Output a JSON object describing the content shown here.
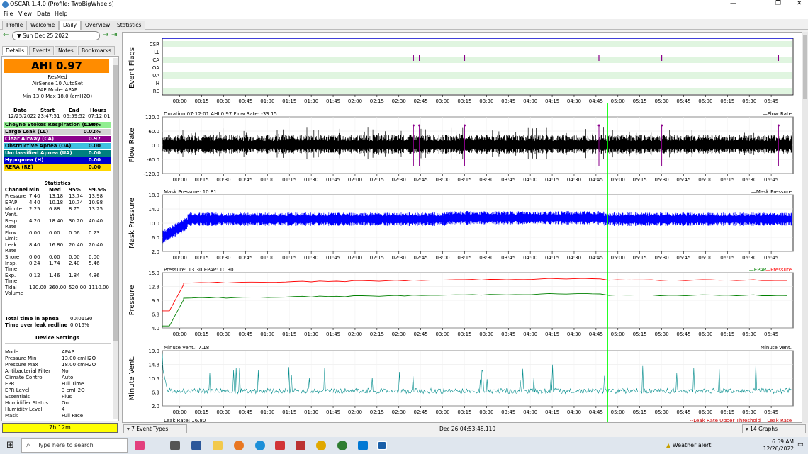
{
  "window": {
    "title": "OSCAR 1.4.0 (Profile: TwoBigWheels)"
  },
  "menu": [
    "File",
    "View",
    "Data",
    "Help"
  ],
  "tabs": [
    "Profile",
    "Welcome",
    "Daily",
    "Overview",
    "Statistics"
  ],
  "active_tab": "Daily",
  "date": "Sun Dec 25 2022",
  "left_tabs": [
    "Details",
    "Events",
    "Notes",
    "Bookmarks"
  ],
  "ahi": "AHI 0.97",
  "device": {
    "brand": "ResMed",
    "model": "AirSense 10 AutoSet",
    "pap_mode": "PAP Mode: APAP",
    "pressure_range": "Min 13.0 Max 18.0 (cmH2O)"
  },
  "session": {
    "headers": [
      "Date",
      "Start",
      "End",
      "Hours"
    ],
    "values": [
      "12/25/2022",
      "23:47:51",
      "06:59:52",
      "07:12:01"
    ]
  },
  "events": [
    {
      "label": "Cheyne Stokes Respiration (CSR)",
      "value": "0.00%",
      "color": "#90ee90",
      "text_color": "#000"
    },
    {
      "label": "Large Leak (LL)",
      "value": "0.02%",
      "color": "#d3d3d3",
      "text_color": "#000"
    },
    {
      "label": "Clear Airway (CA)",
      "value": "0.97",
      "color": "#8b008b",
      "text_color": "#fff"
    },
    {
      "label": "Obstructive Apnea (OA)",
      "value": "0.00",
      "color": "#40c0e0",
      "text_color": "#000"
    },
    {
      "label": "Unclassified Apnea (UA)",
      "value": "0.00",
      "color": "#008080",
      "text_color": "#fff"
    },
    {
      "label": "Hypopnea (H)",
      "value": "0.00",
      "color": "#0000cd",
      "text_color": "#fff"
    },
    {
      "label": "RERA (RE)",
      "value": "0.00",
      "color": "#ffd700",
      "text_color": "#000"
    }
  ],
  "statistics": {
    "title": "Statistics",
    "headers": [
      "Channel",
      "Min",
      "Med",
      "95%",
      "99.5%"
    ],
    "rows": [
      [
        "Pressure",
        "7.40",
        "13.18",
        "13.74",
        "13.98"
      ],
      [
        "EPAP",
        "4.40",
        "10.18",
        "10.74",
        "10.98"
      ],
      [
        "Minute Vent.",
        "2.25",
        "6.88",
        "8.75",
        "13.25"
      ],
      [
        "Resp. Rate",
        "4.20",
        "18.40",
        "30.20",
        "40.40"
      ],
      [
        "Flow Limit.",
        "0.00",
        "0.00",
        "0.06",
        "0.23"
      ],
      [
        "Leak Rate",
        "8.40",
        "16.80",
        "20.40",
        "20.40"
      ],
      [
        "Snore",
        "0.00",
        "0.00",
        "0.00",
        "0.00"
      ],
      [
        "Insp. Time",
        "0.24",
        "1.74",
        "2.40",
        "5.46"
      ],
      [
        "Exp. Time",
        "0.12",
        "1.46",
        "1.84",
        "4.86"
      ],
      [
        "Tidal Volume",
        "120.00",
        "360.00",
        "520.00",
        "1110.00"
      ]
    ],
    "apnea_time_label": "Total time in apnea",
    "apnea_time": "00:01:30",
    "leak_label": "Time over leak redline",
    "leak_value": "0.015%"
  },
  "device_settings": {
    "title": "Device Settings",
    "rows": [
      [
        "Mode",
        "APAP"
      ],
      [
        "Pressure Min",
        "13.00 cmH2O"
      ],
      [
        "Pressure Max",
        "18.00 cmH2O"
      ],
      [
        "Antibacterial Filter",
        "No"
      ],
      [
        "Climate Control",
        "Auto"
      ],
      [
        "EPR",
        "Full Time"
      ],
      [
        "EPR Level",
        "3 cmH2O"
      ],
      [
        "Essentials",
        "Plus"
      ],
      [
        "Humidifier Status",
        "On"
      ],
      [
        "Humidity Level",
        "4"
      ],
      [
        "Mask",
        "Full Face"
      ]
    ]
  },
  "duration": "7h 12m",
  "time_ticks": [
    "00:00",
    "00:15",
    "00:30",
    "00:45",
    "01:00",
    "01:15",
    "01:30",
    "01:45",
    "02:00",
    "02:15",
    "02:30",
    "02:45",
    "03:00",
    "03:15",
    "03:30",
    "03:45",
    "04:00",
    "04:15",
    "04:30",
    "04:45",
    "05:00",
    "05:15",
    "05:30",
    "05:45",
    "06:00",
    "06:15",
    "06:30",
    "06:45"
  ],
  "graphs": {
    "event_flags": {
      "ylabel": "Event Flags",
      "rows": [
        "CSR",
        "LL",
        "CA",
        "OA",
        "UA",
        "H",
        "RE"
      ]
    },
    "flow_rate": {
      "ylabel": "Flow Rate",
      "header": "Duration 07:12:01 AHI 0.97 Flow Rate: -33.15",
      "legend": "Flow Rate",
      "yticks": [
        "120.0",
        "60.0",
        "0.0",
        "-60.0",
        "-120.0"
      ]
    },
    "mask_pressure": {
      "ylabel": "Mask Pressure",
      "header": "Mask Pressure: 10.81",
      "legend": "Mask Pressure",
      "yticks": [
        "18.0",
        "14.0",
        "10.0",
        "6.0",
        "2.0"
      ]
    },
    "pressure": {
      "ylabel": "Pressure",
      "header": "Pressure: 13.30 EPAP: 10.30",
      "legend_epap": "EPAP",
      "legend_pressure": "Pressure",
      "yticks": [
        "15.0",
        "12.3",
        "9.5",
        "6.8",
        "4.0"
      ]
    },
    "minute_vent": {
      "ylabel": "Minute Vent.",
      "header": "Minute Vent.: 7.18",
      "legend": "Minute Vent.",
      "yticks": [
        "19.0",
        "14.8",
        "10.5",
        "6.3",
        "2.0"
      ]
    },
    "leak_rate": {
      "header": "Leak Rate: 16.80",
      "legend": "Leak Rate Upper Threshold",
      "legend2": "Leak Rate"
    }
  },
  "ca_event_times": [
    "02:40",
    "02:44",
    "03:15",
    "04:47",
    "05:30",
    "06:50"
  ],
  "bottom": {
    "event_types": "7 Event Types",
    "cursor_time": "Dec 26 04:53:48.110",
    "graphs_count": "14 Graphs"
  },
  "taskbar": {
    "search_placeholder": "Type here to search",
    "weather": "Weather alert",
    "time": "6:59 AM",
    "date": "12/26/2022"
  },
  "colors": {
    "ahi": "#ff8c00",
    "flow": "#000000",
    "mask_pressure": "#0000ff",
    "pressure": "#ff0000",
    "epap": "#008000",
    "minute_vent": "#008b8b",
    "ca_event": "#8b008b",
    "cursor": "#00ff00",
    "duration": "#ffff00"
  }
}
